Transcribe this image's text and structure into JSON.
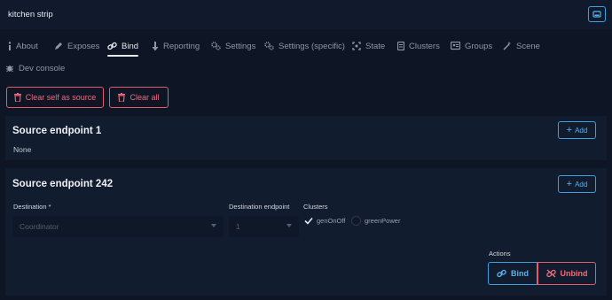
{
  "app": {
    "title": "kitchen strip"
  },
  "tabs": [
    {
      "label": "About",
      "icon": "info-icon"
    },
    {
      "label": "Exposes",
      "icon": "pencil-icon"
    },
    {
      "label": "Bind",
      "icon": "link-icon",
      "active": true
    },
    {
      "label": "Reporting",
      "icon": "arrow-down-icon"
    },
    {
      "label": "Settings",
      "icon": "cogs-icon"
    },
    {
      "label": "Settings (specific)",
      "icon": "cogs-icon"
    },
    {
      "label": "State",
      "icon": "state-icon"
    },
    {
      "label": "Clusters",
      "icon": "file-icon"
    },
    {
      "label": "Groups",
      "icon": "groups-icon"
    },
    {
      "label": "Scene",
      "icon": "wand-icon"
    },
    {
      "label": "Dev console",
      "icon": "bug-icon"
    }
  ],
  "actions_top": {
    "clear_self": "Clear self as source",
    "clear_all": "Clear all"
  },
  "endpoint1": {
    "title": "Source endpoint 1",
    "add_label": "Add",
    "value": "None"
  },
  "endpoint242": {
    "title": "Source endpoint 242",
    "add_label": "Add",
    "destination_label": "Destination *",
    "destination_value": "Coordinator",
    "dest_endpoint_label": "Destination endpoint",
    "dest_endpoint_value": "1",
    "clusters_label": "Clusters",
    "clusters": [
      {
        "name": "genOnOff",
        "checked": true
      },
      {
        "name": "greenPower",
        "checked": false
      }
    ],
    "actions_label": "Actions",
    "bind_label": "Bind",
    "unbind_label": "Unbind"
  },
  "colors": {
    "background": "#0e1626",
    "card": "#121c2f",
    "accent_blue": "#3b9fe0",
    "danger": "#e35a6d"
  }
}
